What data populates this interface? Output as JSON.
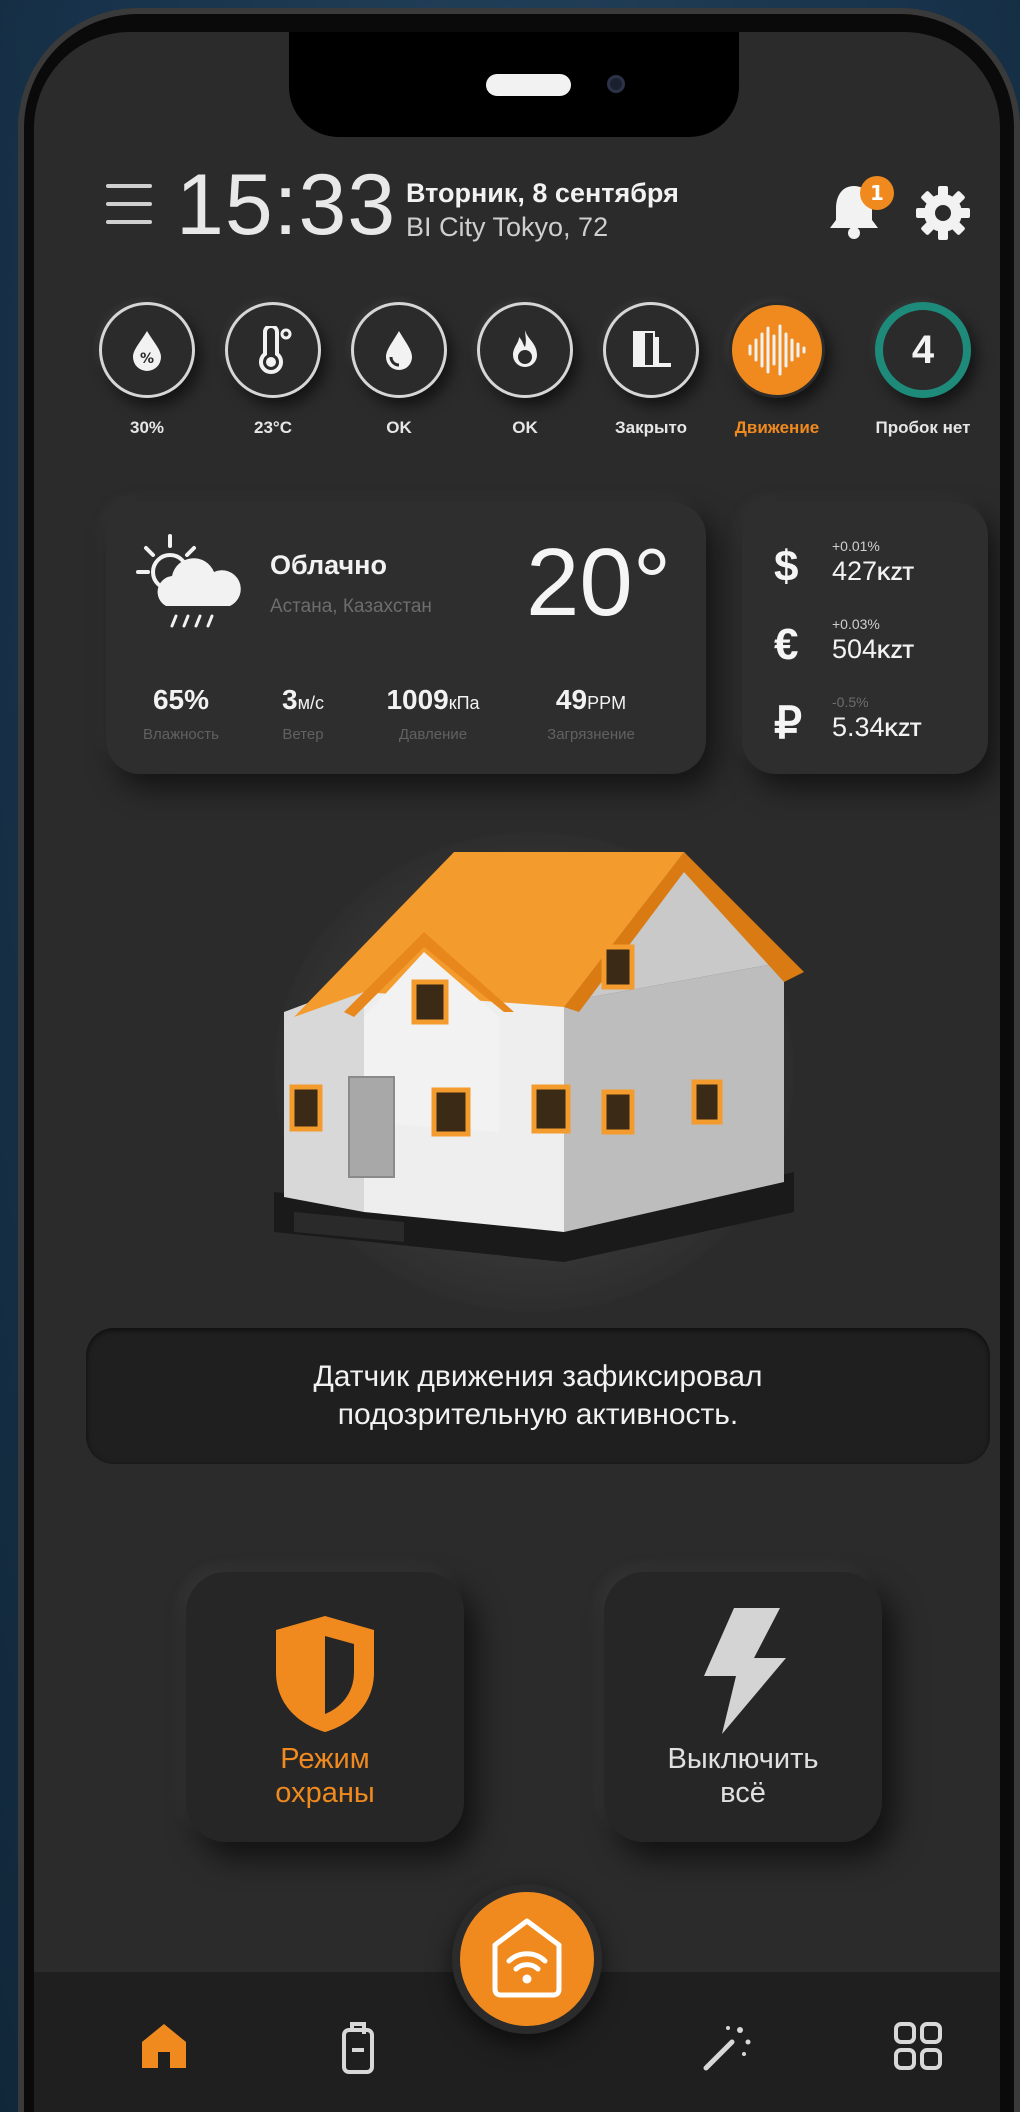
{
  "header": {
    "time": "15:33",
    "date": "Вторник, 8 сентября",
    "address": "BI City Tokyo, 72",
    "notification_count": "1",
    "icons": [
      "menu-icon",
      "bell-icon",
      "gear-icon"
    ]
  },
  "sensors": [
    {
      "icon": "humidity-drop-icon",
      "label": "30%"
    },
    {
      "icon": "thermometer-icon",
      "label": "23°C"
    },
    {
      "icon": "water-leak-icon",
      "label": "OK"
    },
    {
      "icon": "fire-icon",
      "label": "OK"
    },
    {
      "icon": "door-icon",
      "label": "Закрыто"
    },
    {
      "icon": "motion-wave-icon",
      "label": "Движение",
      "active": true
    },
    {
      "icon": "traffic-score-icon",
      "value": "4",
      "label": "Пробок нет"
    }
  ],
  "weather": {
    "condition": "Облачно",
    "city": "Астана, Казахстан",
    "temperature": "20°",
    "stats": [
      {
        "value": "65%",
        "unit": "",
        "label": "Влажность"
      },
      {
        "value": "3",
        "unit": "м/с",
        "label": "Ветер"
      },
      {
        "value": "1009",
        "unit": "кПа",
        "label": "Давление"
      },
      {
        "value": "49",
        "unit": "PPM",
        "label": "Загрязнение"
      }
    ]
  },
  "currency": [
    {
      "symbol": "$",
      "change": "+0.01%",
      "value": "427",
      "unit": "KZT"
    },
    {
      "symbol": "€",
      "change": "+0.03%",
      "value": "504",
      "unit": "KZT"
    },
    {
      "symbol": "₽",
      "change": "-0.5%",
      "value": "5.34",
      "unit": "KZT"
    }
  ],
  "alert": {
    "line1": "Датчик движения зафиксировал",
    "line2": "подозрительную активность."
  },
  "actions": {
    "security_line1": "Режим",
    "security_line2": "охраны",
    "power_line1": "Выключить",
    "power_line2": "всё"
  },
  "nav": {
    "items": [
      "home-icon",
      "key-card-icon",
      "magic-wand-icon",
      "grid-icon"
    ],
    "center": "smart-home-wifi-icon"
  },
  "colors": {
    "accent": "#f08a1e",
    "background": "#2b2b2c",
    "card": "#2e2e2f",
    "traffic_ring": "#1d8a7a"
  }
}
